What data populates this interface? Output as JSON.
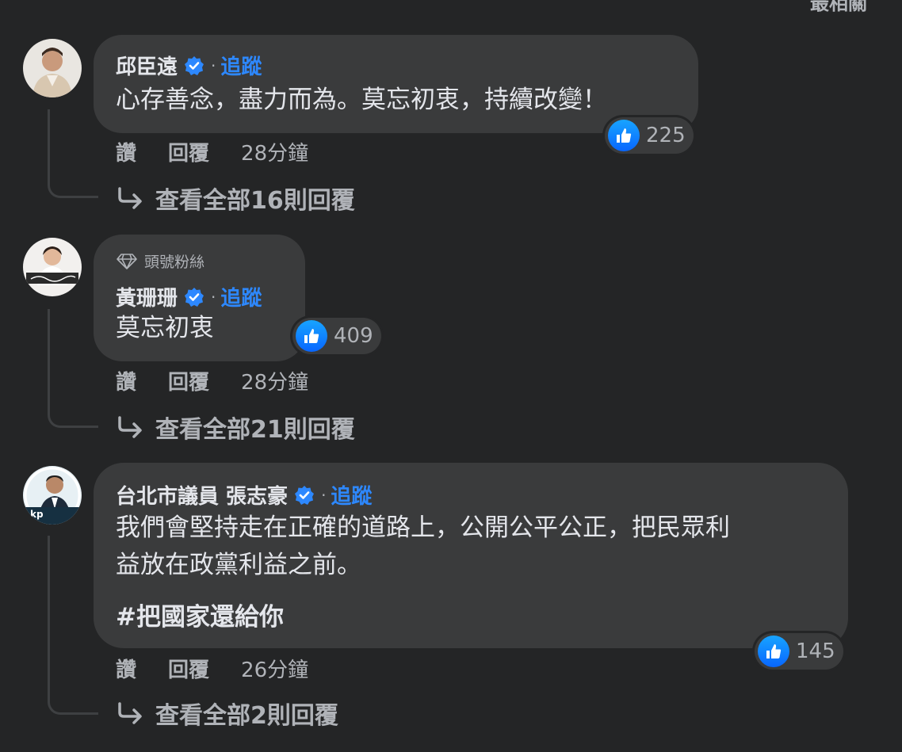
{
  "sort": {
    "label": "最相關"
  },
  "comments": [
    {
      "author": "邱臣遠",
      "verified": true,
      "follow_label": "追蹤",
      "text_lines": [
        "心存善念，盡力而為。莫忘初衷，持續改變！"
      ],
      "reaction_icon": "like-icon",
      "reaction_count": "225",
      "actions": {
        "like": "讚",
        "reply": "回覆",
        "time": "28分鐘"
      },
      "view_replies": "查看全部16則回覆"
    },
    {
      "badge": "頭號粉絲",
      "author": "黃珊珊",
      "verified": true,
      "follow_label": "追蹤",
      "text_lines": [
        "莫忘初衷"
      ],
      "reaction_icon": "like-icon",
      "reaction_count": "409",
      "actions": {
        "like": "讚",
        "reply": "回覆",
        "time": "28分鐘"
      },
      "view_replies": "查看全部21則回覆"
    },
    {
      "author": "台北市議員 張志豪",
      "verified": true,
      "follow_label": "追蹤",
      "text_lines": [
        "我們會堅持走在正確的道路上，公開公平公正，把民眾利",
        "益放在政黨利益之前。"
      ],
      "hashtag": "#把國家還給你",
      "reaction_icon": "like-icon",
      "reaction_count": "145",
      "actions": {
        "like": "讚",
        "reply": "回覆",
        "time": "26分鐘"
      },
      "view_replies": "查看全部2則回覆"
    }
  ],
  "colors": {
    "background": "#242526",
    "bubble": "#3a3b3c",
    "accent": "#2d88ff",
    "text_primary": "#e4e6eb",
    "text_secondary": "#b0b3b8"
  }
}
